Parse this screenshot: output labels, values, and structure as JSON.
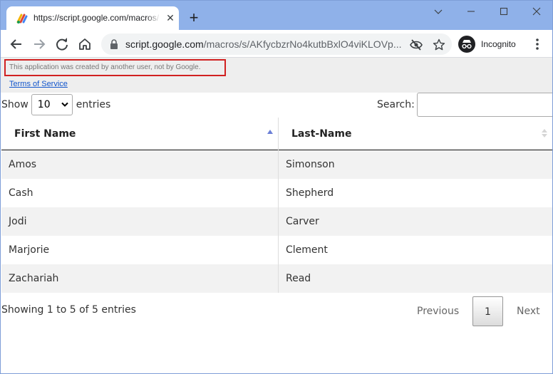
{
  "browser": {
    "tab_title": "https://script.google.com/macros/s/",
    "new_tab_symbol": "+",
    "close_symbol": "✕",
    "url_host": "script.google.com",
    "url_path": "/macros/s/AKfycbzrNo4kutbBxlO4viKLOVp...",
    "profile_label": "Incognito"
  },
  "page": {
    "warning": "This application was created by another user, not by Google.",
    "terms_link": "Terms of Service",
    "length_prefix": "Show",
    "length_value": "10",
    "length_suffix": "entries",
    "search_label": "Search:",
    "search_value": ""
  },
  "table": {
    "columns": [
      {
        "label": "First Name",
        "sort": "ascending"
      },
      {
        "label": "Last-Name",
        "sort": "both"
      }
    ],
    "rows": [
      {
        "first": "Amos",
        "last": "Simonson"
      },
      {
        "first": "Cash",
        "last": "Shepherd"
      },
      {
        "first": "Jodi",
        "last": "Carver"
      },
      {
        "first": "Marjorie",
        "last": "Clement"
      },
      {
        "first": "Zachariah",
        "last": "Read"
      }
    ]
  },
  "footer": {
    "info": "Showing 1 to 5 of 5 entries",
    "previous": "Previous",
    "current_page": "1",
    "next": "Next"
  },
  "colors": {
    "tabstrip": "#8fb1e9",
    "warning_border": "#d12121",
    "link": "#1155cc",
    "sort_active": "#6b7fd6"
  }
}
